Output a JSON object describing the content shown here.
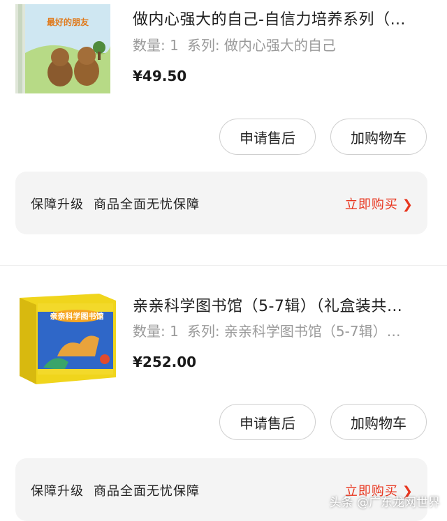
{
  "orders": [
    {
      "title": "做内心强大的自己-自信力培养系列（…",
      "quantity_label": "数量: 1",
      "series_label": "系列: 做内心强大的自己",
      "price": "¥49.50",
      "cover_text": "最好的朋友",
      "after_sale_label": "申请售后",
      "add_cart_label": "加购物车",
      "guarantee_title": "保障升级",
      "guarantee_desc": "商品全面无忧保障",
      "buy_now_label": "立即购买",
      "chevron": "❯"
    },
    {
      "title": "亲亲科学图书馆（5-7辑）（礼盒装共…",
      "quantity_label": "数量: 1",
      "series_label": "系列: 亲亲科学图书馆（5-7辑）…",
      "price": "¥252.00",
      "cover_text": "亲亲科学图书馆",
      "after_sale_label": "申请售后",
      "add_cart_label": "加购物车",
      "guarantee_title": "保障升级",
      "guarantee_desc": "商品全面无忧保障",
      "buy_now_label": "立即购买",
      "chevron": "❯"
    }
  ],
  "watermark": "头条 @广东龙网世界",
  "colors": {
    "accent": "#e8361f",
    "panel": "#f4f4f4",
    "muted": "#9a9a9a"
  }
}
